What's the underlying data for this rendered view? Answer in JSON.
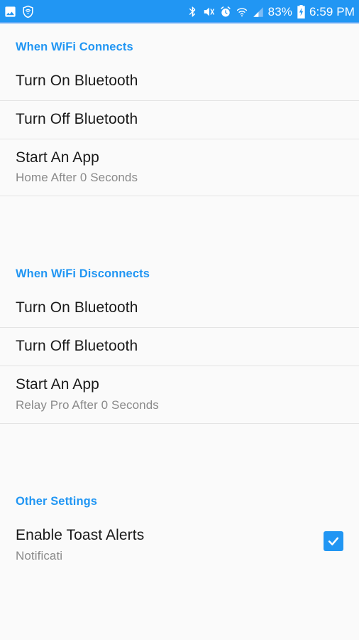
{
  "status_bar": {
    "left_icons": [
      "image-icon",
      "wifi-shield-icon"
    ],
    "right_icons": [
      "bluetooth-icon",
      "volume-mute-vibrate-icon",
      "alarm-icon",
      "wifi-icon",
      "cell-signal-icon"
    ],
    "battery_percent": "83%",
    "battery_icon": "battery-charging-icon",
    "time": "6:59 PM",
    "background_color": "#2196f3"
  },
  "accent_color": "#2196f3",
  "sections": [
    {
      "header": "When WiFi Connects",
      "items": [
        {
          "title": "Turn On Bluetooth",
          "subtitle": ""
        },
        {
          "title": "Turn Off Bluetooth",
          "subtitle": ""
        },
        {
          "title": "Start An App",
          "subtitle": "Home After 0 Seconds"
        }
      ]
    },
    {
      "header": "When WiFi Disconnects",
      "items": [
        {
          "title": "Turn On Bluetooth",
          "subtitle": ""
        },
        {
          "title": "Turn Off Bluetooth",
          "subtitle": ""
        },
        {
          "title": "Start An App",
          "subtitle": "Relay Pro After 0 Seconds"
        }
      ]
    },
    {
      "header": "Other Settings",
      "items": [
        {
          "title": "Enable Toast Alerts",
          "subtitle": "Notificati",
          "checked": true
        }
      ]
    }
  ]
}
